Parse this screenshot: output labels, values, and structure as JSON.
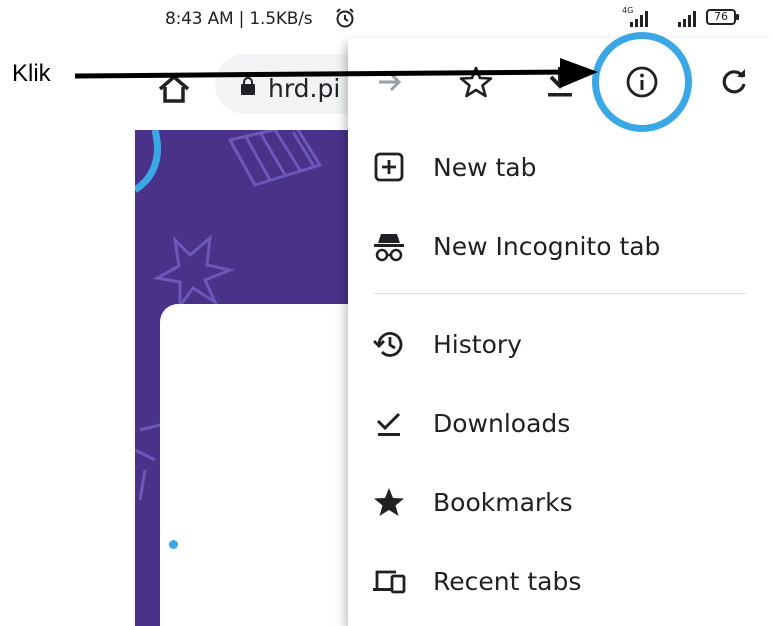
{
  "status_bar": {
    "time_speed": "8:43 AM | 1.5KB/s",
    "network_type": "4G",
    "battery": "76",
    "icons": [
      "alarm-icon",
      "signal-icon",
      "signal-icon",
      "battery-icon"
    ]
  },
  "toolbar": {
    "url_text": "hrd.pi",
    "icons": [
      "home-icon",
      "lock-icon"
    ]
  },
  "menu": {
    "top_icons": [
      "forward-icon",
      "star-icon",
      "download-icon",
      "info-icon",
      "reload-icon"
    ],
    "items": [
      {
        "label": "New tab",
        "icon": "plus-box-icon"
      },
      {
        "label": "New Incognito tab",
        "icon": "incognito-icon"
      },
      {
        "label": "History",
        "icon": "history-icon"
      },
      {
        "label": "Downloads",
        "icon": "download-check-icon"
      },
      {
        "label": "Bookmarks",
        "icon": "star-filled-icon"
      },
      {
        "label": "Recent tabs",
        "icon": "devices-icon"
      }
    ]
  },
  "annotation": {
    "label": "Klik",
    "highlight_color": "#3aa8e6",
    "arrow_color": "#000000"
  },
  "colors": {
    "page_background": "#4a3189",
    "accent_dot": "#3aa8e6",
    "text": "#202124"
  }
}
